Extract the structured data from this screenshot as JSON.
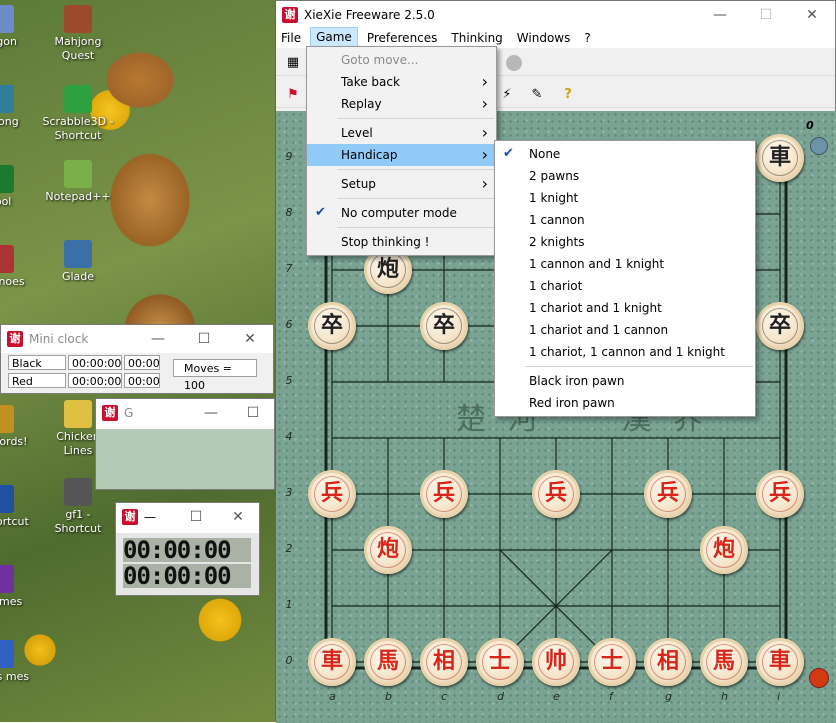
{
  "desktop": {
    "icons": [
      {
        "label": "xagon",
        "color": "#6c8cc7"
      },
      {
        "label": "Mahjong Quest",
        "color": "#9b4a2a"
      },
      {
        "label": "ahjong",
        "color": "#2f7f9a"
      },
      {
        "label": "Scrabble3D - Shortcut",
        "color": "#2fa040"
      },
      {
        "label": "Pool",
        "color": "#1c7a2e"
      },
      {
        "label": "Notepad++",
        "color": "#78b04a"
      },
      {
        "label": "eal inoes",
        "color": "#a33"
      },
      {
        "label": "Glade",
        "color": "#3a6fa8"
      },
      {
        "label": "ay Words!",
        "color": "#c09020"
      },
      {
        "label": "Chicken Lines",
        "color": "#e0c040"
      },
      {
        "label": "on - ortcut",
        "color": "#2050a0"
      },
      {
        "label": "gf1 - Shortcut",
        "color": "#555"
      },
      {
        "label": "cGames",
        "color": "#7030a0"
      },
      {
        "label": "Cards mes",
        "color": "#3060c0"
      }
    ]
  },
  "main_window": {
    "title": "XieXie Freeware 2.5.0",
    "logo_char": "谢",
    "controls": {
      "minimize": "—",
      "maximize": "☐",
      "close": "✕"
    },
    "menus": [
      "File",
      "Game",
      "Preferences",
      "Thinking",
      "Windows",
      "?"
    ],
    "active_menu": "Game"
  },
  "game_menu": {
    "items": [
      {
        "label": "Goto move...",
        "disabled": true,
        "submenu": false
      },
      {
        "label": "Take back",
        "disabled": false,
        "submenu": true
      },
      {
        "label": "Replay",
        "disabled": false,
        "submenu": true
      },
      {
        "separator": true
      },
      {
        "label": "Level",
        "disabled": false,
        "submenu": true
      },
      {
        "label": "Handicap",
        "disabled": false,
        "submenu": true,
        "selected": true
      },
      {
        "separator": true
      },
      {
        "label": "Setup",
        "disabled": false,
        "submenu": true
      },
      {
        "separator": true
      },
      {
        "label": "No computer mode",
        "checked": true
      },
      {
        "separator": true
      },
      {
        "label": "Stop thinking !",
        "disabled": false
      }
    ]
  },
  "handicap_menu": {
    "items": [
      {
        "label": "None",
        "checked": true
      },
      {
        "label": "2 pawns"
      },
      {
        "label": "1 knight"
      },
      {
        "label": "1 cannon"
      },
      {
        "label": "2 knights"
      },
      {
        "label": "1 cannon and 1 knight"
      },
      {
        "label": "1 chariot"
      },
      {
        "label": "1 chariot and 1 knight"
      },
      {
        "label": "1 chariot and 1 cannon"
      },
      {
        "label": "1 chariot, 1 cannon and 1 knight"
      },
      {
        "separator": true
      },
      {
        "label": "Black iron pawn"
      },
      {
        "label": "Red iron pawn"
      }
    ]
  },
  "board": {
    "ranks": [
      "9",
      "8",
      "7",
      "6",
      "5",
      "4",
      "3",
      "2",
      "1",
      "0"
    ],
    "files": [
      "a",
      "b",
      "c",
      "d",
      "e",
      "f",
      "g",
      "h",
      "i"
    ],
    "corner_label": "0",
    "river_text": "楚 河     漢 界",
    "pieces": [
      {
        "char": "車",
        "side": "black",
        "col": 8,
        "row": 9
      },
      {
        "char": "炮",
        "side": "black",
        "col": 1,
        "row": 7
      },
      {
        "char": "卒",
        "side": "black",
        "col": 0,
        "row": 6
      },
      {
        "char": "卒",
        "side": "black",
        "col": 2,
        "row": 6
      },
      {
        "char": "卒",
        "side": "black",
        "col": 8,
        "row": 6
      },
      {
        "char": "兵",
        "side": "red",
        "col": 0,
        "row": 3
      },
      {
        "char": "兵",
        "side": "red",
        "col": 2,
        "row": 3
      },
      {
        "char": "兵",
        "side": "red",
        "col": 4,
        "row": 3
      },
      {
        "char": "兵",
        "side": "red",
        "col": 6,
        "row": 3
      },
      {
        "char": "兵",
        "side": "red",
        "col": 8,
        "row": 3
      },
      {
        "char": "炮",
        "side": "red",
        "col": 1,
        "row": 2
      },
      {
        "char": "炮",
        "side": "red",
        "col": 7,
        "row": 2
      },
      {
        "char": "車",
        "side": "red",
        "col": 0,
        "row": 0
      },
      {
        "char": "馬",
        "side": "red",
        "col": 1,
        "row": 0
      },
      {
        "char": "相",
        "side": "red",
        "col": 2,
        "row": 0
      },
      {
        "char": "士",
        "side": "red",
        "col": 3,
        "row": 0
      },
      {
        "char": "帅",
        "side": "red",
        "col": 4,
        "row": 0
      },
      {
        "char": "士",
        "side": "red",
        "col": 5,
        "row": 0
      },
      {
        "char": "相",
        "side": "red",
        "col": 6,
        "row": 0
      },
      {
        "char": "馬",
        "side": "red",
        "col": 7,
        "row": 0
      },
      {
        "char": "車",
        "side": "red",
        "col": 8,
        "row": 0
      }
    ]
  },
  "mini_clock": {
    "title": "Mini clock",
    "rows": [
      {
        "side": "Black",
        "time": "00:00:00",
        "extra": "00:00"
      },
      {
        "side": "Red",
        "time": "00:00:00",
        "extra": "00:00"
      }
    ],
    "moves": "Moves = 100"
  },
  "graph_window": {
    "title": "G"
  },
  "lcd_clock": {
    "title": "—",
    "lines": [
      "00:00:00",
      "00:00:00"
    ]
  },
  "colors": {
    "menu_highlight": "#91c9f7",
    "red_piece": "#d8261a",
    "board": "#7aa394",
    "accent": "#1a73c8"
  }
}
